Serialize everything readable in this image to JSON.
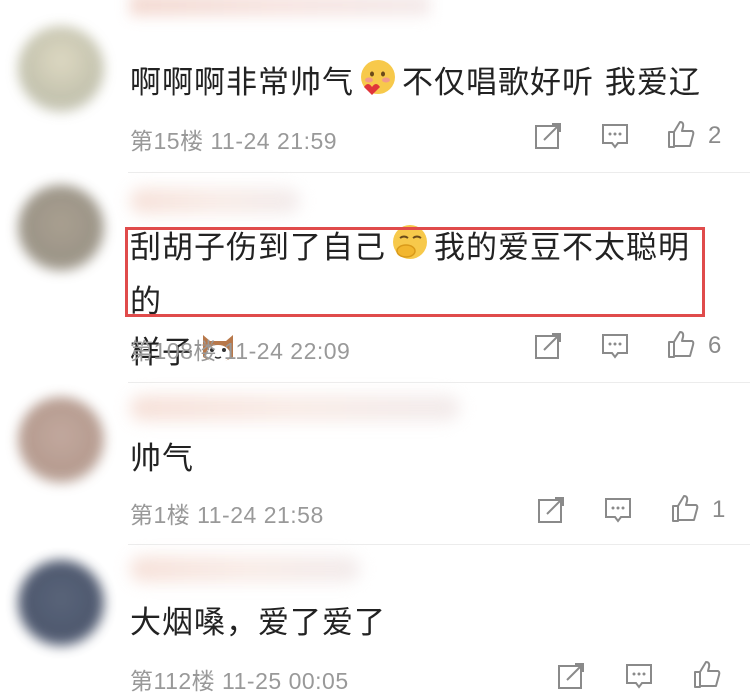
{
  "comments": [
    {
      "text_parts": [
        "啊啊啊非常帅气",
        "不仅唱歌好听 我爱辽"
      ],
      "emojis": [
        "love-face-emoji"
      ],
      "floor_label": "第15楼 11-24 21:59",
      "like_count": "2"
    },
    {
      "text_parts": [
        "刮胡子伤到了自己",
        "我的爱豆不太聪明的",
        "样子"
      ],
      "emojis": [
        "cover-face-emoji",
        "cat-emoji"
      ],
      "floor_label": "第108楼 11-24 22:09",
      "like_count": "6"
    },
    {
      "text_parts": [
        "帅气"
      ],
      "emojis": [],
      "floor_label": "第1楼 11-24 21:58",
      "like_count": "1"
    },
    {
      "text_parts": [
        "大烟嗓，爱了爱了"
      ],
      "emojis": [],
      "floor_label": "第112楼 11-25 00:05",
      "like_count": ""
    }
  ],
  "colors": {
    "text": "#222222",
    "meta": "#999999",
    "icon": "#8a8a8a",
    "highlight_border": "#e04b4b"
  }
}
